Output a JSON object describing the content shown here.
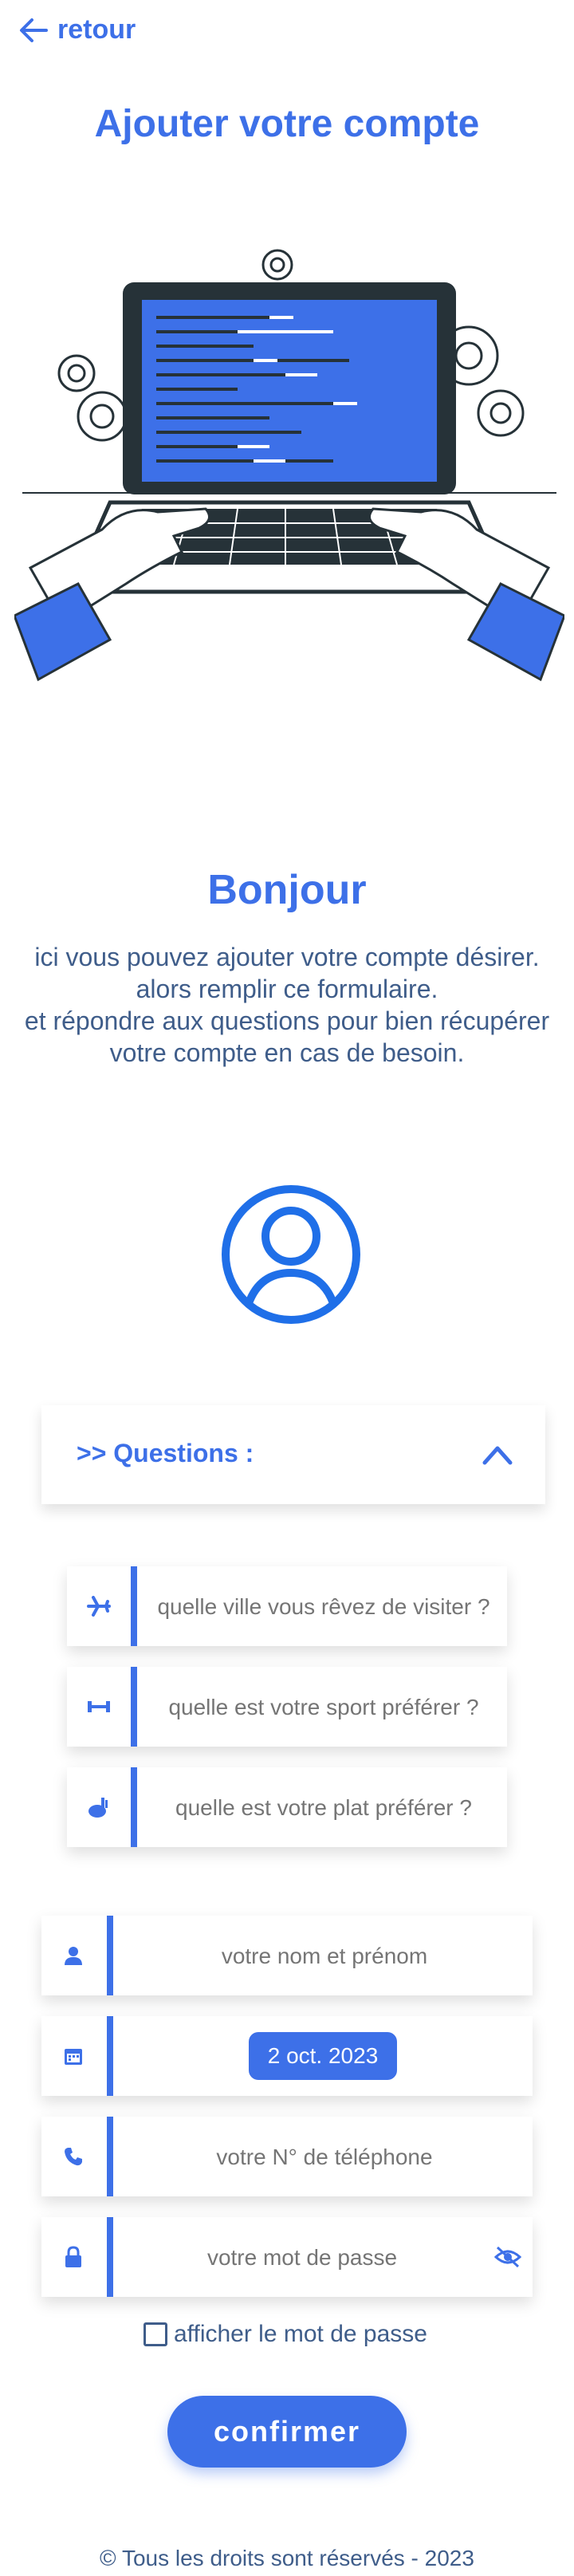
{
  "nav": {
    "back_label": "retour"
  },
  "page": {
    "title": "Ajouter votre compte"
  },
  "intro": {
    "heading": "Bonjour",
    "lines": [
      "ici vous pouvez ajouter votre compte désirer.",
      "alors remplir ce formulaire.",
      "et répondre aux questions pour bien récupérer",
      "votre compte en cas de besoin."
    ]
  },
  "questions": {
    "label": ">> Questions :",
    "expanded": true,
    "fields": [
      {
        "icon": "airplane-icon",
        "placeholder": "quelle ville vous rêvez de visiter ?"
      },
      {
        "icon": "dumbbell-icon",
        "placeholder": "quelle est votre sport préférer ?"
      },
      {
        "icon": "food-icon",
        "placeholder": "quelle est votre plat préférer ?"
      }
    ]
  },
  "form": {
    "name": {
      "icon": "person-icon",
      "placeholder": "votre nom et prénom"
    },
    "date": {
      "icon": "calendar-icon",
      "value": "2 oct. 2023"
    },
    "phone": {
      "icon": "phone-icon",
      "placeholder": "votre N° de téléphone"
    },
    "password": {
      "icon": "lock-icon",
      "placeholder": "votre mot de passe",
      "toggle_icon": "eye-off-icon"
    },
    "show_password_label": "afficher le mot de passe",
    "show_password_checked": false,
    "confirm_label": "confirmer"
  },
  "footer": {
    "text": "© Tous les droits sont réservés - 2023"
  },
  "colors": {
    "accent": "#3d70e8",
    "text_secondary": "#3f5d8a",
    "placeholder": "#a9a9a9",
    "dark": "#263238"
  }
}
